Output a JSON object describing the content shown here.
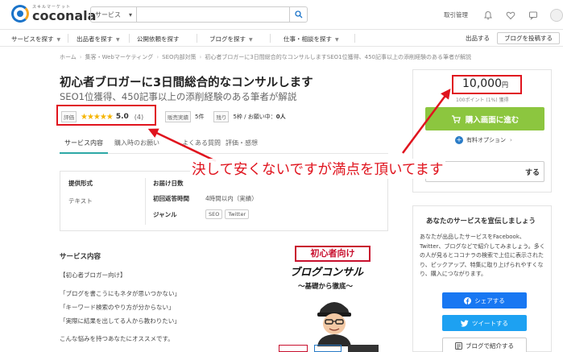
{
  "header": {
    "logo_sub": "スキルマーケット",
    "logo_main": "coconala",
    "search_category": "サービス",
    "search_placeholder": "",
    "link_trade": "取引管理"
  },
  "nav": {
    "items": [
      "サービスを探す",
      "出品者を探す",
      "公開依頼を探す",
      "ブログを探す",
      "仕事・相談を探す"
    ],
    "sell": "出品する",
    "post_blog": "ブログを投稿する"
  },
  "breadcrumb": [
    "ホーム",
    "集客・Webマーケティング",
    "SEO内部対策",
    "初心者ブロガーに3日間総合的なコンサルしますSEO1位獲得、450記事以上の添削経験のある筆者が解説"
  ],
  "service": {
    "title": "初心者ブロガーに3日間総合的なコンサルします",
    "subtitle": "SEO1位獲得、450記事以上の添削経験のある筆者が解説",
    "rating_label": "評価",
    "stars": "★★★★★",
    "rating": "5.0",
    "review_count": "(4)",
    "sales_label": "販売実績",
    "sales_value": "5件",
    "remaining_label": "残り",
    "remaining_value": "5枠 / お願い中：",
    "requesting_value": "0人"
  },
  "tabs": [
    "サービス内容",
    "購入時のお願い",
    "よくある質問",
    "評価・感想"
  ],
  "spec": {
    "format_h": "提供形式",
    "format_v": "テキスト",
    "delivery_h": "お届け日数",
    "reply_k": "初回返答時間",
    "reply_v": "4時間以内（実績）",
    "genre_k": "ジャンル",
    "genre_chips": [
      "SEO",
      "Twitter"
    ]
  },
  "body": {
    "heading": "サービス内容",
    "lines": [
      "【初心者ブロガー向け】",
      "「ブログを書こうにもネタが思いつかない」",
      "「キーワード検索のやり方が分からない」",
      "「実際に結果を出してる人から教わりたい」",
      "こんな悩みを持つあなたにオススメです。"
    ]
  },
  "hero": {
    "line1": "初心者向け",
    "line2": "ブログコンサル",
    "line3": "〜基礎から徹底〜"
  },
  "buy": {
    "price": "10,000",
    "price_unit": "円",
    "points": "100ポイント (1%) 獲得",
    "buy_button": "購入画面に進む",
    "option": "有料オプション",
    "fav_text": "する"
  },
  "promo": {
    "title": "あなたのサービスを宣伝しましょう",
    "text": "あなたが出品したサービスをFacebook、Twitter、ブログなどで紹介してみましょう。多くの人が見るとココナラの検索で上位に表示されたり、ピックアップ、特集に取り上げられやすくなり、購入につながります。",
    "share": "シェアする",
    "tweet": "ツイートする",
    "blog": "ブログで紹介する"
  },
  "annotation": {
    "text": "決して安くないですが満点を頂いてます"
  },
  "colors": {
    "accent_teal": "#2da8a6",
    "buy_green": "#8cc63f",
    "annotation_red": "#e0141e",
    "facebook_blue": "#1877f2",
    "twitter_blue": "#1da1f2",
    "star_gold": "#f5b400"
  }
}
